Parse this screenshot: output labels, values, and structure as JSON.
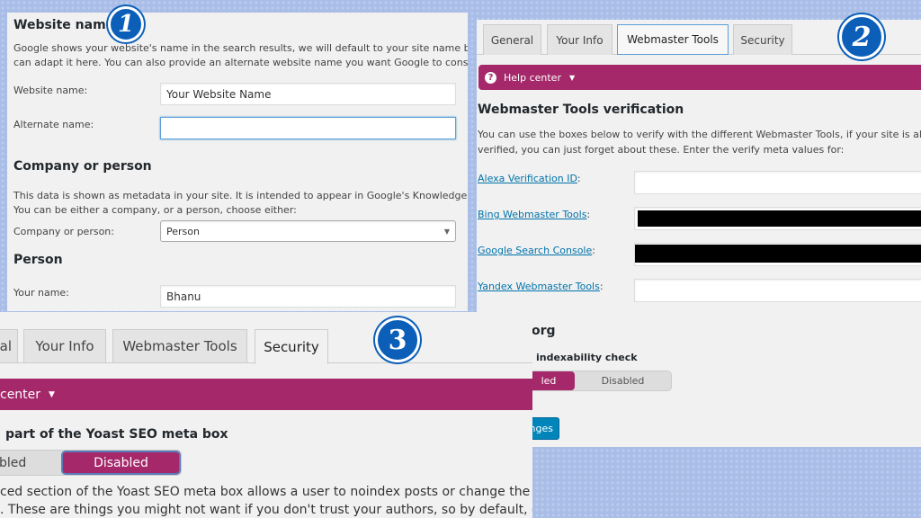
{
  "colors": {
    "accent_purple": "#a4286a",
    "badge_blue": "#0c5fb8",
    "button_blue": "#0085ba",
    "background": "#a9bde6"
  },
  "panel1": {
    "badge": "1",
    "title": "Website name",
    "description": [
      "Google shows your website's name in the search results, we will default to your site name but you",
      "can adapt it here. You can also provide an alternate website name you want Google to consider."
    ],
    "website_name_label": "Website name:",
    "website_name_value": "Your Website Name",
    "alternate_name_label": "Alternate name:",
    "alternate_name_value": "",
    "company_heading": "Company or person",
    "company_description": [
      "This data is shown as metadata in your site. It is intended to appear in Google's Knowledge Graph.",
      "You can be either a company, or a person, choose either:"
    ],
    "company_label": "Company or person:",
    "company_value": "Person",
    "person_heading": "Person",
    "your_name_label": "Your name:",
    "your_name_value": "Bhanu"
  },
  "panel2": {
    "badge": "2",
    "tabs": [
      "General",
      "Your Info",
      "Webmaster Tools",
      "Security"
    ],
    "active_tab": "Webmaster Tools",
    "help_center": "Help center",
    "heading": "Webmaster Tools verification",
    "description": [
      "You can use the boxes below to verify with the different Webmaster Tools, if your site is alread",
      "verified, you can just forget about these. Enter the verify meta values for:"
    ],
    "fields": [
      {
        "label": "Alexa Verification ID",
        "redacted": false
      },
      {
        "label": "Bing Webmaster Tools",
        "redacted": true
      },
      {
        "label": "Google Search Console",
        "redacted": true
      },
      {
        "label": "Yandex Webmaster Tools",
        "redacted": false
      }
    ],
    "partial_heading": "org",
    "partial_label": "indexability check",
    "toggle_on": "led",
    "toggle_off": "Disabled",
    "save_partial": "nges"
  },
  "panel3": {
    "badge": "3",
    "tabs": [
      "al",
      "Your Info",
      "Webmaster Tools",
      "Security"
    ],
    "active_tab": "Security",
    "help_center_partial": "center",
    "heading_partial": "part of the Yoast SEO meta box",
    "toggle_enabled_partial": "bled",
    "toggle_disabled": "Disabled",
    "description": [
      "ced section of the Yoast SEO meta box allows a user to noindex posts or change the",
      ". These are things you might not want if you don't trust your authors, so by default, only"
    ]
  }
}
